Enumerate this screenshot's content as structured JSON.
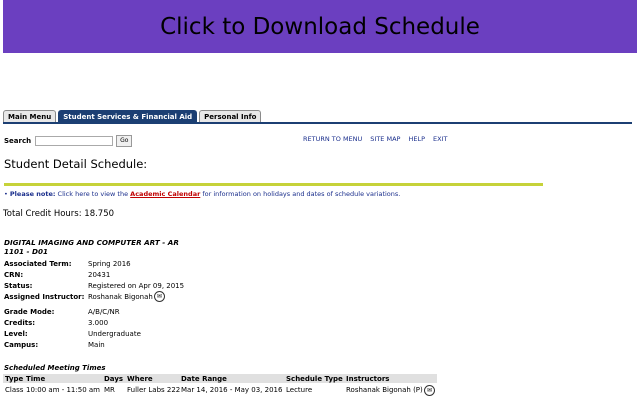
{
  "banner": {
    "label": "Click to Download Schedule"
  },
  "tabs": [
    {
      "label": "Main Menu",
      "active": false
    },
    {
      "label": "Student Services & Financial Aid",
      "active": true
    },
    {
      "label": "Personal Info",
      "active": false
    }
  ],
  "search": {
    "label": "Search",
    "value": "",
    "go": "Go"
  },
  "toplinks": [
    "RETURN TO MENU",
    "SITE MAP",
    "HELP",
    "EXIT"
  ],
  "page_title": "Student Detail Schedule:",
  "note": {
    "prefix": "Please note:",
    "text1": " Click here to view the ",
    "link": "Academic Calendar",
    "text2": " for information on holidays and dates of schedule variations."
  },
  "total_credit_hours": "Total Credit Hours: 18.750",
  "course": {
    "title_line1": "DIGITAL IMAGING AND COMPUTER ART - AR",
    "title_line2": "1101 - D01",
    "details": [
      {
        "key": "Associated Term:",
        "value": "Spring 2016"
      },
      {
        "key": "CRN:",
        "value": "20431"
      },
      {
        "key": "Status:",
        "value": "Registered on Apr 09, 2015"
      },
      {
        "key": "Assigned Instructor:",
        "value": "Roshanak Bigonah"
      },
      {
        "key": "Grade Mode:",
        "value": "A/B/C/NR"
      },
      {
        "key": "Credits:",
        "value": "3.000"
      },
      {
        "key": "Level:",
        "value": "Undergraduate"
      },
      {
        "key": "Campus:",
        "value": "Main"
      }
    ]
  },
  "meeting_times": {
    "caption": "Scheduled Meeting Times",
    "headers": [
      "Type",
      "Time",
      "Days",
      "Where",
      "Date Range",
      "Schedule Type",
      "Instructors"
    ],
    "rows": [
      [
        "Class",
        "10:00 am - 11:50 am",
        "MR",
        "Fuller Labs 222",
        "Mar 14, 2016 - May 03, 2016",
        "Lecture",
        "Roshanak Bigonah (P)"
      ]
    ]
  },
  "colors": {
    "banner": "#6b3fc0",
    "tab_active": "#1c3f73",
    "divider": "#c6d239",
    "link": "#1a2e8c",
    "alert": "#c00000"
  }
}
